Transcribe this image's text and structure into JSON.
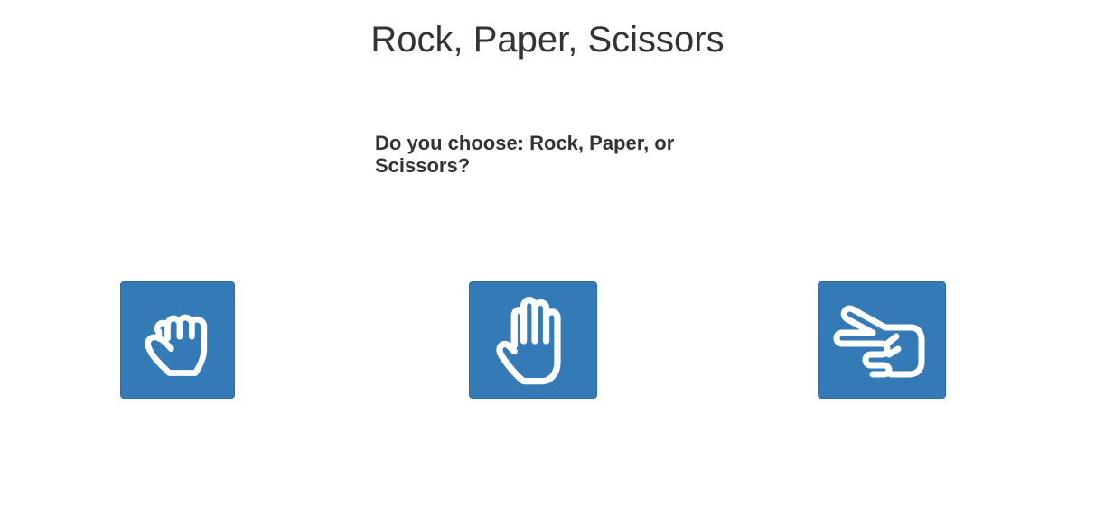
{
  "page": {
    "title": "Rock, Paper, Scissors",
    "prompt": "Do you choose: Rock, Paper, or Scissors?"
  },
  "choices": [
    {
      "name": "Rock",
      "icon": "fist-icon"
    },
    {
      "name": "Paper",
      "icon": "open-hand-icon"
    },
    {
      "name": "Scissors",
      "icon": "scissors-hand-icon"
    }
  ],
  "colors": {
    "button": "#337ab7",
    "icon": "#ffffff",
    "text": "#333333"
  }
}
